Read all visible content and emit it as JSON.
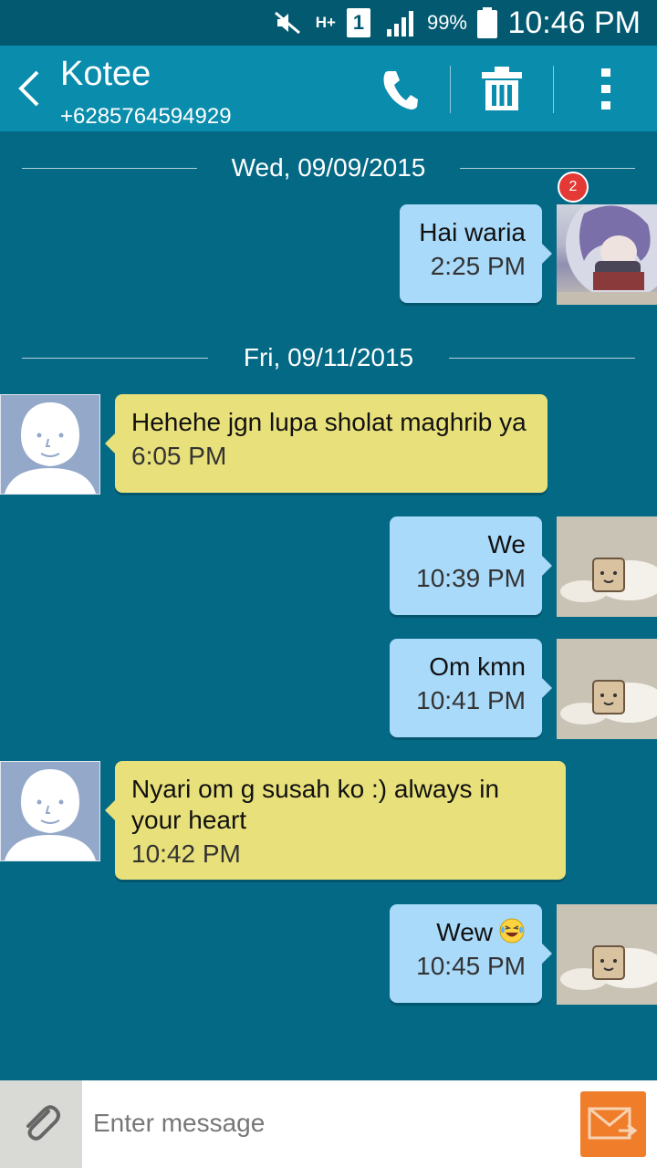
{
  "status_bar": {
    "network": "H+",
    "sim": "1",
    "battery": "99%",
    "time": "10:46 PM"
  },
  "header": {
    "contact_name": "Kotee",
    "contact_number": "+6285764594929"
  },
  "conversation": {
    "badge_count": "2",
    "date_separators": [
      "Wed, 09/09/2015",
      "Fri, 09/11/2015"
    ],
    "messages": [
      {
        "direction": "outgoing",
        "text": "Hai waria",
        "time": "2:25 PM"
      },
      {
        "direction": "incoming",
        "text": "Hehehe jgn lupa sholat maghrib ya",
        "time": "6:05 PM"
      },
      {
        "direction": "outgoing",
        "text": "We",
        "time": "10:39 PM"
      },
      {
        "direction": "outgoing",
        "text": "Om kmn",
        "time": "10:41 PM"
      },
      {
        "direction": "incoming",
        "text": "Nyari om g susah ko :) always in your heart",
        "time": "10:42 PM"
      },
      {
        "direction": "outgoing",
        "text": "Wew",
        "emoji": "laughing-tears-emoji",
        "time": "10:45 PM"
      }
    ]
  },
  "compose": {
    "placeholder": "Enter message",
    "value": ""
  },
  "colors": {
    "background": "#046985",
    "app_bar": "#0a8cac",
    "outgoing_bubble": "#a9dafa",
    "incoming_bubble": "#e8e07a",
    "send_button": "#ef7d2a",
    "badge": "#e53935"
  },
  "icons": [
    "mute-icon",
    "signal-icon",
    "battery-icon",
    "back-icon",
    "phone-icon",
    "trash-icon",
    "more-icon",
    "paperclip-icon",
    "send-icon"
  ]
}
